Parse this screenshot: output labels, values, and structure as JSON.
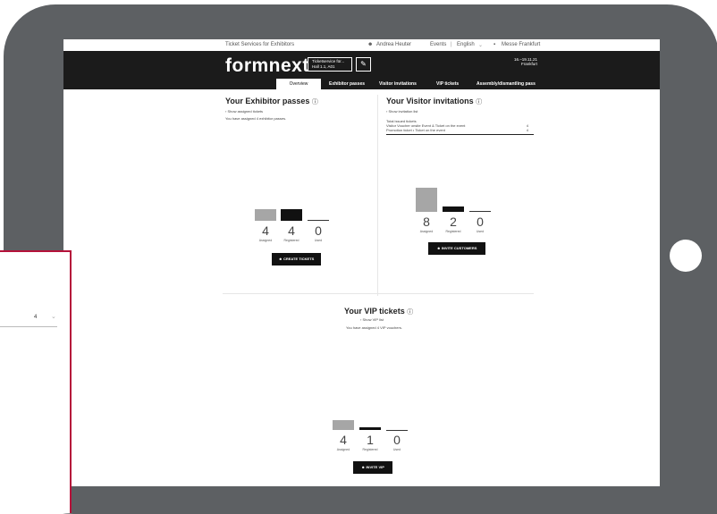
{
  "topbar": {
    "title": "Ticket Services for Exhibitors",
    "user": "Andrea Heuter",
    "events": "Events",
    "lang": "English",
    "company": "Messe Frankfurt"
  },
  "header": {
    "logo": "formnext",
    "select_line1": "Ticketservice für...",
    "select_line2": "Hall 1.1, A01",
    "date_line1": "16.–19.11.21",
    "date_line2": "Frankfurt"
  },
  "nav": [
    "Overview",
    "Exhibitor passes",
    "Visitor invitations",
    "VIP tickets",
    "Assembly/dismantling pass"
  ],
  "exhibitor": {
    "title": "Your Exhibitor passes",
    "link": "Show assigned tickets",
    "text": "You have assigned 4 exhibitor passes.",
    "stats": [
      {
        "value": "4",
        "label": "Assigned"
      },
      {
        "value": "4",
        "label": "Registered"
      },
      {
        "value": "0",
        "label": "Used"
      }
    ],
    "button": "CREATE TICKETS"
  },
  "visitor": {
    "title": "Your Visitor invitations",
    "link": "Show invitation list",
    "rows": [
      {
        "label": "Total issued tickets",
        "value": ""
      },
      {
        "label": "Visitor Voucher onsite Event & Ticket on the event",
        "value": "4"
      },
      {
        "label": "Promotion ticket • Ticket on the event",
        "value": "4"
      }
    ],
    "stats": [
      {
        "value": "8",
        "label": "Assigned"
      },
      {
        "value": "2",
        "label": "Registered"
      },
      {
        "value": "0",
        "label": "Used"
      }
    ],
    "button": "INVITE CUSTOMERS"
  },
  "vip": {
    "title": "Your VIP tickets",
    "link": "Show VIP list",
    "text": "You have assigned 4 VIP vouchers.",
    "stats": [
      {
        "value": "4",
        "label": "Assigned"
      },
      {
        "value": "1",
        "label": "Registered"
      },
      {
        "value": "0",
        "label": "Used"
      }
    ],
    "button": "INVITE VIP"
  },
  "panel": {
    "value": "4"
  },
  "colors": {
    "tablet": "#5d6063",
    "header": "#1b1b1b",
    "accent": "#b5123a",
    "bar_grey": "#a6a6a6"
  }
}
